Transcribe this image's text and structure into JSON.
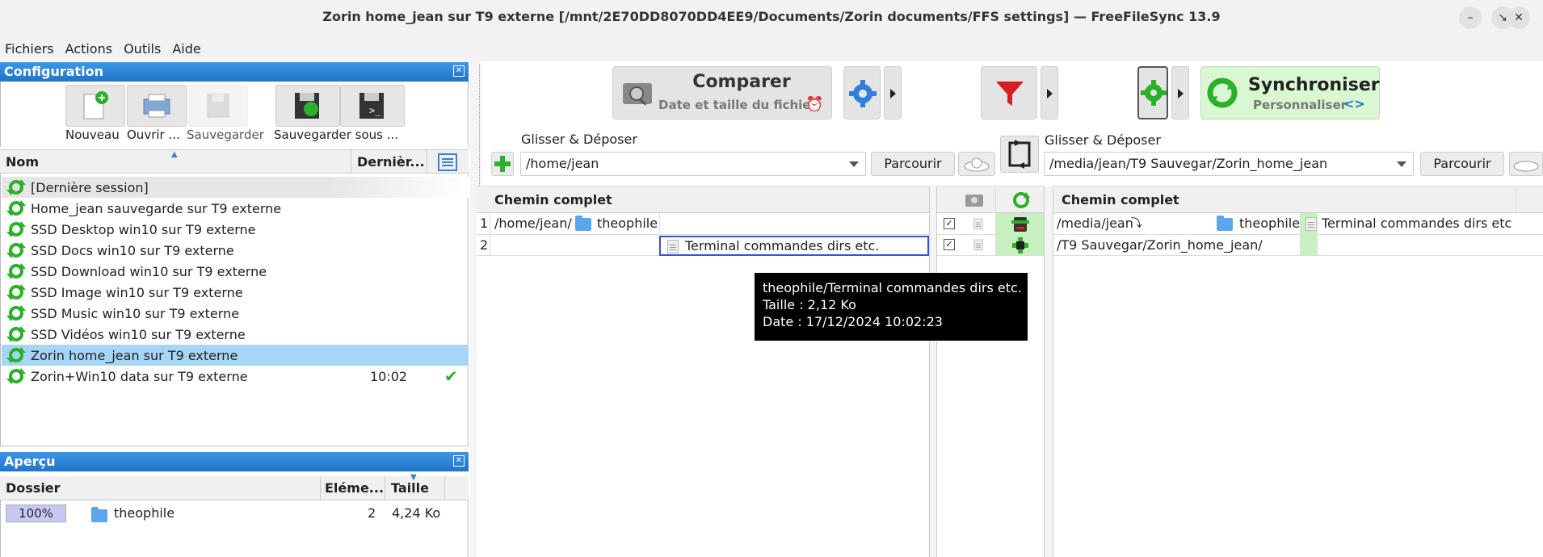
{
  "window": {
    "title": "Zorin home_jean sur T9 externe [/mnt/2E70DD8070DD4EE9/Documents/Zorin documents/FFS settings] — FreeFileSync 13.9"
  },
  "menu": [
    "Fichiers",
    "Actions",
    "Outils",
    "Aide"
  ],
  "config_panel": {
    "title": "Configuration",
    "toolbar": [
      "Nouveau",
      "Ouvrir ...",
      "Sauvegarder",
      "Sauvegarder sous ..."
    ],
    "col_name": "Nom",
    "col_last": "Dernièr...",
    "items": [
      {
        "name": "[Dernière session]",
        "time": "",
        "ok": false
      },
      {
        "name": "Home_jean sauvegarde sur T9 externe",
        "time": "",
        "ok": false
      },
      {
        "name": "SSD Desktop win10 sur T9 externe",
        "time": "",
        "ok": false
      },
      {
        "name": "SSD Docs win10 sur T9 externe",
        "time": "",
        "ok": false
      },
      {
        "name": "SSD Download win10 sur T9 externe",
        "time": "",
        "ok": false
      },
      {
        "name": "SSD Image win10 sur T9 externe",
        "time": "",
        "ok": false
      },
      {
        "name": "SSD Music win10 sur T9 externe",
        "time": "",
        "ok": false
      },
      {
        "name": "SSD Vidéos win10 sur T9 externe",
        "time": "",
        "ok": false
      },
      {
        "name": "Zorin home_jean sur T9 externe",
        "time": "",
        "ok": false
      },
      {
        "name": "Zorin+Win10 data sur T9 externe",
        "time": "10:02",
        "ok": true
      }
    ],
    "selected_index": 8
  },
  "overview_panel": {
    "title": "Aperçu",
    "col_folder": "Dossier",
    "col_items": "Eléme...",
    "col_size": "Taille",
    "row": {
      "percent": "100%",
      "folder": "theophile",
      "items": "2",
      "size": "4,24 Ko"
    }
  },
  "toolbar": {
    "compare_title": "Comparer",
    "compare_sub": "Date et taille du fichier",
    "sync_title": "Synchroniser",
    "sync_sub": "Personnaliser"
  },
  "left_location": {
    "drag_label": "Glisser & Déposer",
    "path": "/home/jean",
    "browse": "Parcourir"
  },
  "right_location": {
    "drag_label": "Glisser & Déposer",
    "path": "/media/jean/T9 Sauvegar/Zorin_home_jean",
    "browse": "Parcourir"
  },
  "left_grid": {
    "header": "Chemin complet",
    "rows": [
      {
        "num": "1",
        "path": "/home/jean/",
        "folder": "theophile",
        "file": ""
      },
      {
        "num": "2",
        "path": "",
        "folder": "",
        "file": "Terminal commandes dirs etc."
      }
    ]
  },
  "right_grid": {
    "header": "Chemin complet",
    "rows": [
      {
        "path": "/media/jean",
        "folder": "theophile",
        "file": "Terminal commandes dirs etc"
      },
      {
        "path": "/T9 Sauvegar/Zorin_home_jean/",
        "folder": "",
        "file": ""
      }
    ]
  },
  "tooltip": {
    "line1": "theophile/Terminal commandes dirs etc.",
    "line2": "Taille : 2,12 Ko",
    "line3": "Date : 17/12/2024  10:02:23"
  },
  "colors": {
    "header_blue": "#2a83d8",
    "selected_row": "#a6d5f5",
    "sync_green": "#d9f7d0",
    "progress": "#c8c8f5"
  }
}
